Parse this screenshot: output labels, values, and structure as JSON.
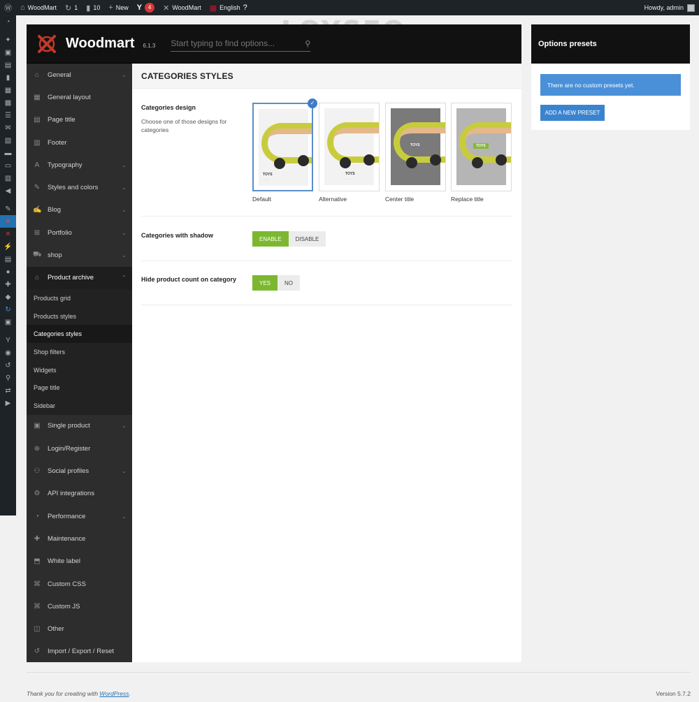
{
  "adminbar": {
    "site_name": "WoodMart",
    "updates_count": "1",
    "comments_count": "10",
    "new_label": "New",
    "seo_badge": "4",
    "theme_link": "WoodMart",
    "language": "English",
    "howdy": "Howdy, admin"
  },
  "watermark": "LOYSEO",
  "panel": {
    "logo_text": "Woodmart",
    "version": "6.1.3",
    "search_placeholder": "Start typing to find options..."
  },
  "sidebar": {
    "items_top": [
      {
        "label": "General",
        "icon": "home-icon",
        "glyph": "⌂",
        "chevron": true
      },
      {
        "label": "General layout",
        "icon": "layout-icon",
        "glyph": "▦",
        "chevron": false
      },
      {
        "label": "Page title",
        "icon": "page-title-icon",
        "glyph": "▤",
        "chevron": false
      },
      {
        "label": "Footer",
        "icon": "footer-icon",
        "glyph": "▥",
        "chevron": false
      },
      {
        "label": "Typography",
        "icon": "typography-icon",
        "glyph": "A",
        "chevron": true
      },
      {
        "label": "Styles and colors",
        "icon": "brush-icon",
        "glyph": "✎",
        "chevron": true
      },
      {
        "label": "Blog",
        "icon": "blog-icon",
        "glyph": "✍",
        "chevron": true
      },
      {
        "label": "Portfolio",
        "icon": "portfolio-icon",
        "glyph": "⊞",
        "chevron": true
      },
      {
        "label": "shop",
        "icon": "cart-icon",
        "glyph": "⛟",
        "chevron": true
      }
    ],
    "open_item": {
      "label": "Product archive",
      "icon": "store-icon",
      "glyph": "⌂"
    },
    "sub_items": [
      "Products grid",
      "Products styles",
      "Categories styles",
      "Shop filters",
      "Widgets",
      "Page title",
      "Sidebar"
    ],
    "active_sub": 2,
    "items_bottom": [
      {
        "label": "Single product",
        "icon": "product-icon",
        "glyph": "▣",
        "chevron": true
      },
      {
        "label": "Login/Register",
        "icon": "login-icon",
        "glyph": "⊕",
        "chevron": false
      },
      {
        "label": "Social profiles",
        "icon": "social-icon",
        "glyph": "⚇",
        "chevron": true
      },
      {
        "label": "API integrations",
        "icon": "api-icon",
        "glyph": "⚙",
        "chevron": false
      },
      {
        "label": "Performance",
        "icon": "performance-icon",
        "glyph": "◔",
        "chevron": true
      },
      {
        "label": "Maintenance",
        "icon": "maintenance-icon",
        "glyph": "✚",
        "chevron": false
      },
      {
        "label": "White label",
        "icon": "tag-icon",
        "glyph": "⬒",
        "chevron": false
      },
      {
        "label": "Custom CSS",
        "icon": "css-icon",
        "glyph": "⌘",
        "chevron": false
      },
      {
        "label": "Custom JS",
        "icon": "js-icon",
        "glyph": "⌘",
        "chevron": false
      },
      {
        "label": "Other",
        "icon": "other-icon",
        "glyph": "◫",
        "chevron": false
      },
      {
        "label": "Import / Export / Reset",
        "icon": "reset-icon",
        "glyph": "↺",
        "chevron": false
      }
    ]
  },
  "content": {
    "section_title": "CATEGORIES STYLES",
    "categories_design": {
      "title": "Categories design",
      "desc": "Choose one of those designs for categories",
      "options": [
        "Default",
        "Alternative",
        "Center title",
        "Replace title"
      ],
      "selected": 0,
      "toy_label": "TOYS"
    },
    "shadow": {
      "title": "Categories with shadow",
      "on": "ENABLE",
      "off": "DISABLE"
    },
    "hide_count": {
      "title": "Hide product count on category",
      "on": "YES",
      "off": "NO"
    }
  },
  "presets": {
    "title": "Options presets",
    "message": "There are no custom presets yet.",
    "add_button": "ADD A NEW PRESET"
  },
  "footer": {
    "thanks_prefix": "Thank you for creating with ",
    "wp_link": "WordPress",
    "thanks_suffix": ".",
    "version": "Version 5.7.2"
  },
  "colors": {
    "accent_green": "#7cb82f",
    "accent_blue": "#4a90d9",
    "logo_red": "#c0392b"
  }
}
